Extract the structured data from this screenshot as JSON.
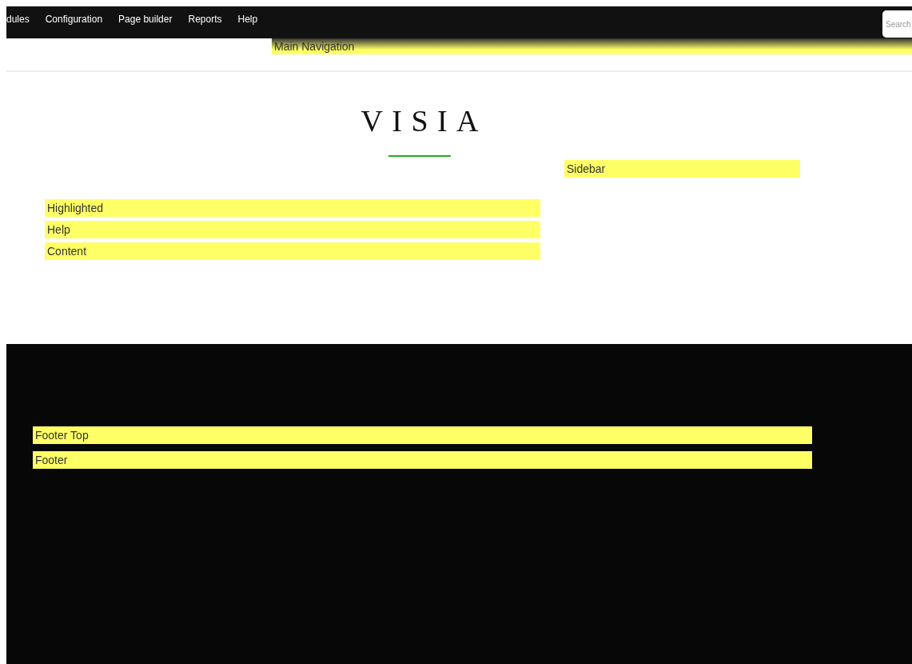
{
  "toolbar": {
    "menu": [
      {
        "label": "dules"
      },
      {
        "label": "Configuration"
      },
      {
        "label": "Page builder"
      },
      {
        "label": "Reports"
      },
      {
        "label": "Help"
      }
    ],
    "search": {
      "placeholder": "Search"
    }
  },
  "main_navigation": {
    "label": "Main Navigation"
  },
  "logo": {
    "text": "VISIA"
  },
  "sidebar": {
    "label": "Sidebar"
  },
  "content_regions": [
    {
      "label": "Highlighted"
    },
    {
      "label": "Help"
    },
    {
      "label": "Content"
    }
  ],
  "footer_regions": [
    {
      "label": "Footer Top"
    },
    {
      "label": "Footer"
    }
  ]
}
